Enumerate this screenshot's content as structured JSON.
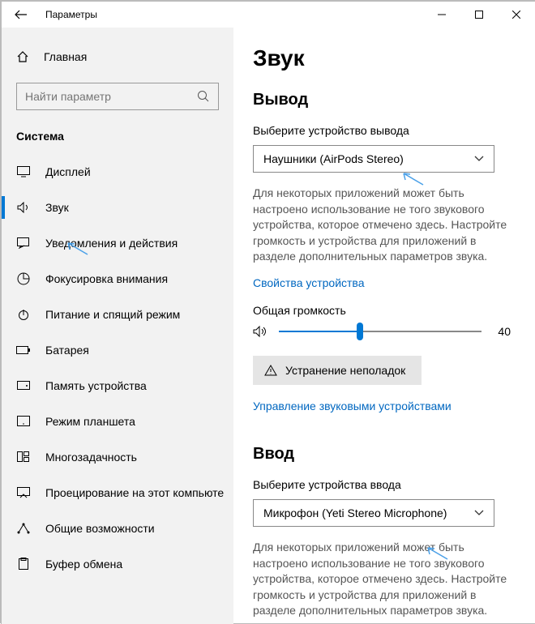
{
  "window": {
    "title": "Параметры"
  },
  "sidebar": {
    "home_label": "Главная",
    "search_placeholder": "Найти параметр",
    "category": "Система",
    "items": [
      {
        "label": "Дисплей"
      },
      {
        "label": "Звук"
      },
      {
        "label": "Уведомления и действия"
      },
      {
        "label": "Фокусировка внимания"
      },
      {
        "label": "Питание и спящий режим"
      },
      {
        "label": "Батарея"
      },
      {
        "label": "Память устройства"
      },
      {
        "label": "Режим планшета"
      },
      {
        "label": "Многозадачность"
      },
      {
        "label": "Проецирование на этот компьютер"
      },
      {
        "label": "Общие возможности"
      },
      {
        "label": "Буфер обмена"
      }
    ]
  },
  "main": {
    "heading": "Звук",
    "output": {
      "title": "Вывод",
      "select_label": "Выберите устройство вывода",
      "selected": "Наушники (AirPods Stereo)",
      "description": "Для некоторых приложений может быть настроено использование не того звукового устройства, которое отмечено здесь. Настройте громкость и устройства для приложений в разделе дополнительных параметров звука.",
      "props_link": "Свойства устройства",
      "volume_label": "Общая громкость",
      "volume_value": "40",
      "troubleshoot": "Устранение неполадок",
      "manage_link": "Управление звуковыми устройствами"
    },
    "input": {
      "title": "Ввод",
      "select_label": "Выберите устройства ввода",
      "selected": "Микрофон (Yeti Stereo Microphone)",
      "description": "Для некоторых приложений может быть настроено использование не того звукового устройства, которое отмечено здесь. Настройте громкость и устройства для приложений в разделе дополнительных параметров звука."
    }
  }
}
